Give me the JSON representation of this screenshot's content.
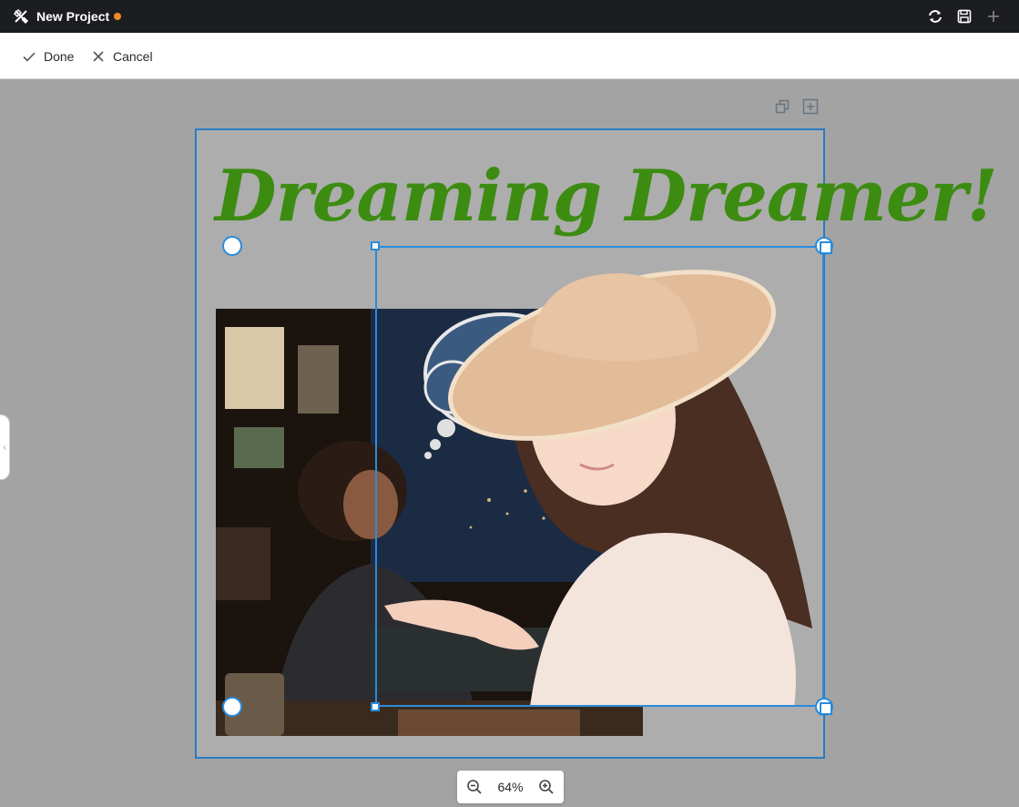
{
  "titlebar": {
    "title": "New Project",
    "unsaved_dot_color": "#f08a24",
    "icons": [
      "tools-icon",
      "sync-icon",
      "save-icon",
      "plus-icon"
    ]
  },
  "toolbar": {
    "done_label": "Done",
    "cancel_label": "Cancel"
  },
  "canvas": {
    "headline": "Dreaming Dreamer!",
    "headline_color": "#3c8c12",
    "selection_color": "#2a8bdc",
    "artboard_border_color": "#2a7bc1",
    "background_color": "#a3a3a3"
  },
  "zoom": {
    "value": "64%"
  }
}
